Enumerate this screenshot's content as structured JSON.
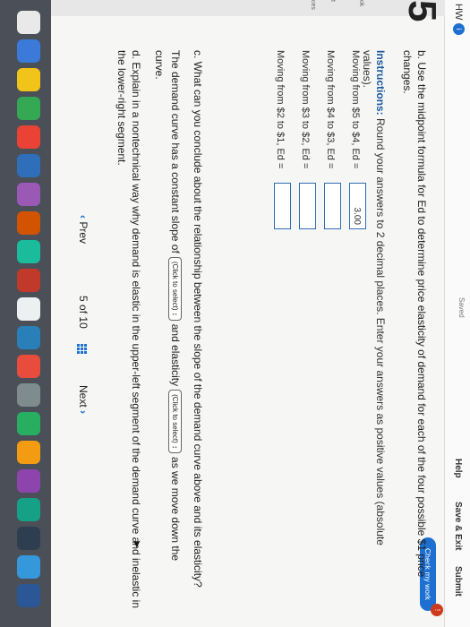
{
  "header": {
    "hw_label": "HW",
    "hw_badge": "i",
    "saved_label": "Saved",
    "help_label": "Help",
    "save_exit_label": "Save & Exit",
    "submit_label": "Submit",
    "check_work_label": "Check my work",
    "check_badge": "!"
  },
  "gutter": {
    "question_number": "5",
    "labels": [
      "ok",
      "t",
      "ces"
    ]
  },
  "question_b": {
    "prompt_line1": "b. Use the midpoint formula for Ed to determine price elasticity of demand for each of the four possible $1 price",
    "prompt_line2": "changes.",
    "instructions_label": "Instructions:",
    "instructions_text": " Round your answers to 2 decimal places. Enter your answers as positive values (absolute values).",
    "rows": [
      {
        "label": "Moving from $5 to $4, Ed =",
        "value": "3.00"
      },
      {
        "label": "Moving from $4 to $3, Ed =",
        "value": ""
      },
      {
        "label": "Moving from $3 to $2, Ed =",
        "value": ""
      },
      {
        "label": "Moving from $2 to $1, Ed =",
        "value": ""
      }
    ]
  },
  "question_c": {
    "prompt": "c. What can you conclude about the relationship between the slope of the demand curve above and its elasticity?",
    "answer_part1": "The demand curve has a constant slope of",
    "select1": "(Click to select)",
    "answer_part2": "and elasticity",
    "select2": "(Click to select)",
    "answer_part3": "as we move down the",
    "answer_part4": "curve."
  },
  "question_d": {
    "prompt_line1": "d. Explain in a nontechnical way why demand is elastic in the upper-left segment of the demand curve and inelastic in",
    "prompt_line2": "the lower-right segment."
  },
  "navigation": {
    "prev_label": "Prev",
    "page_current": "5",
    "page_of": "of",
    "page_total": "10",
    "next_label": "Next"
  },
  "icons": {
    "prev": "chevron-left-icon",
    "next": "chevron-right-icon",
    "pager": "grid-icon"
  },
  "colors": {
    "accent": "#1d6fd1",
    "badge_alert": "#cc3b1c"
  }
}
